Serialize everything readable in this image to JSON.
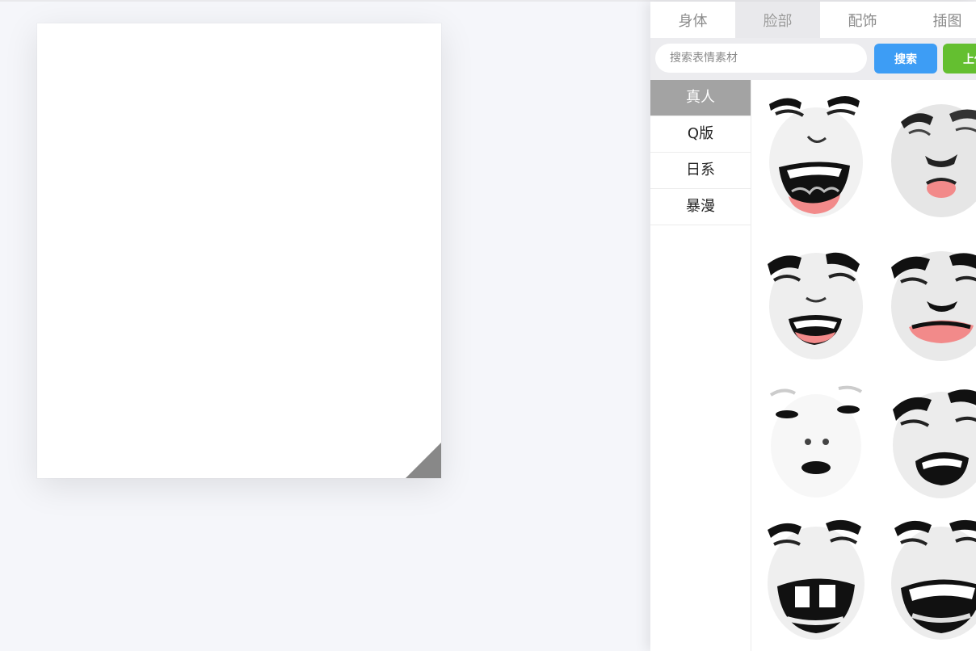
{
  "canvas": {
    "corner_color": "#888888"
  },
  "panel": {
    "tabs": [
      {
        "label": "身体",
        "active": false
      },
      {
        "label": "脸部",
        "active": true
      },
      {
        "label": "配饰",
        "active": false
      },
      {
        "label": "插图",
        "active": false
      }
    ],
    "search": {
      "placeholder": "搜索表情素材",
      "value": "",
      "search_label": "搜索",
      "upload_label": "上传"
    },
    "categories": [
      {
        "label": "真人",
        "active": true
      },
      {
        "label": "Q版",
        "active": false
      },
      {
        "label": "日系",
        "active": false
      },
      {
        "label": "暴漫",
        "active": false
      }
    ],
    "faces": [
      {
        "icon": "laughing-face-icon"
      },
      {
        "icon": "kissing-face-icon"
      },
      {
        "icon": "crying-face-icon"
      },
      {
        "icon": "sad-lips-face-icon"
      },
      {
        "icon": "blank-face-icon"
      },
      {
        "icon": "grimace-face-icon"
      },
      {
        "icon": "gap-tooth-laugh-face-icon"
      },
      {
        "icon": "big-laugh-face-icon"
      }
    ]
  },
  "colors": {
    "search_button": "#3d9df5",
    "upload_button": "#64bf30",
    "active_category": "#a3a3a3",
    "active_tab": "#e9e9ec",
    "lips": "#f28a8a"
  }
}
